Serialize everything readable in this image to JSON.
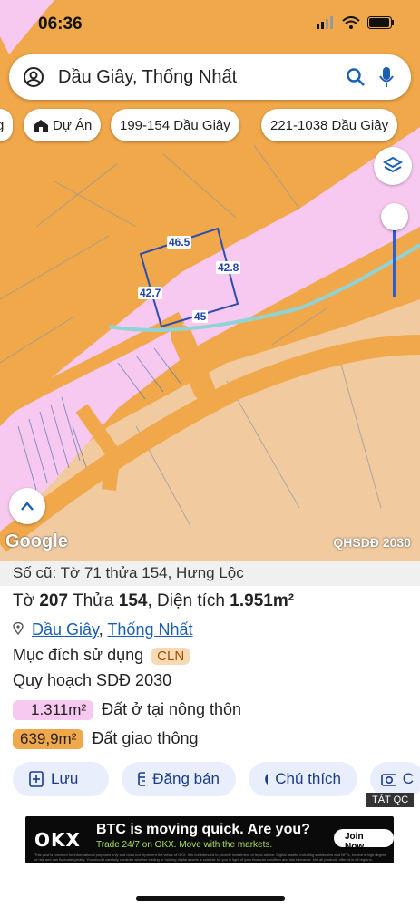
{
  "status": {
    "time": "06:36"
  },
  "search": {
    "query": "Dầu Giây, Thống Nhất"
  },
  "chips": [
    {
      "label": "g"
    },
    {
      "label": "Dự Án"
    },
    {
      "label": "199-154 Dầu Giây"
    },
    {
      "label": "221-1038 Dầu Giây"
    }
  ],
  "map": {
    "dimensions": {
      "top": "46.5",
      "right": "42.8",
      "left": "42.7",
      "bottom": "45"
    },
    "attribution": "Google",
    "plan_tag": "QHSDĐ 2030"
  },
  "parcel": {
    "old_number": "Số cũ: Tờ 71 thửa 154, Hưng Lộc",
    "to_label": "Tờ",
    "to_value": "207",
    "thua_label": "Thửa",
    "thua_value": "154",
    "area_label": "Diện tích",
    "area_value": "1.951m²",
    "location_1": "Dầu Giây",
    "location_sep": ",",
    "location_2": "Thống Nhất",
    "purpose_label": "Mục đích sử dụng",
    "purpose_code": "CLN",
    "plan_label": "Quy hoạch SDĐ 2030",
    "zones": [
      {
        "area": "1.311m²",
        "name": "Đất ở tại nông thôn",
        "color": "#f8c9f0"
      },
      {
        "area": "639,9m²",
        "name": "Đất giao thông",
        "color": "#f0a84a"
      }
    ]
  },
  "actions": [
    {
      "label": "Lưu",
      "icon": "bookmark-plus-icon"
    },
    {
      "label": "Đăng bán",
      "icon": "listing-icon"
    },
    {
      "label": "Chú thích",
      "icon": "contrast-icon"
    },
    {
      "label": "C",
      "icon": "camera-plus-icon"
    }
  ],
  "ad": {
    "tag": "TẮT QC",
    "logo": "OKX",
    "headline": "BTC is moving quick. Are you?",
    "subline": "Trade 24/7 on OKX. Move with the markets.",
    "cta": "Join Now",
    "fine_print": "This post is provided for informational purposes only and does not represent the views of OKX. It is not intended to provide investment or legal advice. Digital assets, including stablecoins and NFTs, involve a high degree of risk and can fluctuate greatly. You should carefully consider whether trading or holding digital assets is suitable for you in light of your financial condition and risk tolerance. Not all products offered in all regions."
  },
  "colors": {
    "residential": "#f8c9f0",
    "traffic": "#f0a84a",
    "agri": "#f2caa0",
    "accent": "#1a5fb4"
  }
}
